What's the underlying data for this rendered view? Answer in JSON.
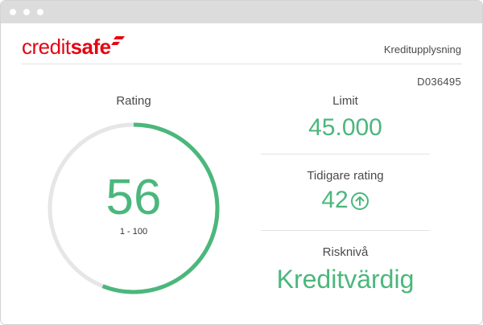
{
  "brand": {
    "logo_part1": "credit",
    "logo_part2": "safe",
    "accent_color": "#e30613"
  },
  "header": {
    "title": "Kreditupplysning",
    "company_id": "D036495"
  },
  "rating": {
    "label": "Rating",
    "value": "56",
    "range": "1 - 100",
    "gauge_fill_fraction": 0.56,
    "fill_color": "#4bb77c",
    "track_color": "#e6e6e6"
  },
  "limit": {
    "label": "Limit",
    "value": "45.000"
  },
  "previous_rating": {
    "label": "Tidigare rating",
    "value": "42",
    "trend_icon": "arrow-up-circle-icon"
  },
  "risk_level": {
    "label": "Risknivå",
    "value": "Kreditvärdig"
  }
}
